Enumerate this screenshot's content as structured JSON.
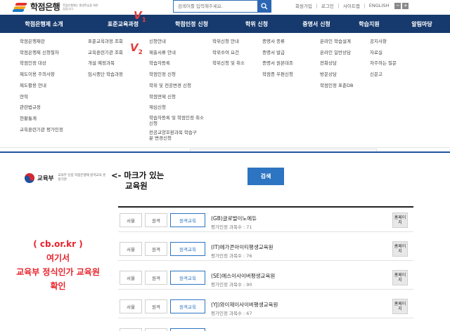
{
  "header": {
    "logo_text": "학점은행",
    "logo_sub": "학점은행제는 평생학습을 위한 길입니다.",
    "search_placeholder": "검색어를 입력해주세요.",
    "utils": [
      "회원가입",
      "로그인",
      "사이트맵",
      "ENGLISH"
    ],
    "font_minus": "−",
    "font_plus": "+"
  },
  "gnb": [
    "학점은행제 소개",
    "표준교육과정",
    "학점인정 신청",
    "학위 신청",
    "증명서 신청",
    "학습지원",
    "알림마당"
  ],
  "annotations": {
    "v1": "V",
    "v1_sub": "1",
    "v2": "V",
    "v2_sub": "2"
  },
  "dropdown": {
    "col0": [
      "학점은행제란",
      "학점은행제 신청절차",
      "학점인정 대상",
      "제도이용 주의사항",
      "제도활용 안내",
      "연혁",
      "관련법규정",
      "현황통계",
      "교육훈련기관 평가인정"
    ],
    "col1": [
      "표준교육과정 조회",
      "교육훈련기관 조회",
      "개설 예정과목",
      "임시중단 학습과정"
    ],
    "col2": [
      "신청안내",
      "제출서류 안내",
      "학습자등록",
      "학점인정 신청",
      "학위 및 전공변경 신청",
      "학점면제 신청",
      "재심신청",
      "학습자등록 및 학점인정 취소 신청",
      "전공교양호환과목 학습구분 변경신청"
    ],
    "col3": [
      "학위신청 안내",
      "학위수여 요건",
      "학위신청 및 취소"
    ],
    "col4": [
      "증명서 종류",
      "증명서 발급",
      "증명서 원본대조",
      "학점증 우편신청"
    ],
    "col5": [
      "온라인 학습설계",
      "온라인 일반상담",
      "전화상담",
      "방문상담",
      "학점인정 표준DB"
    ],
    "col6": [
      "공지사항",
      "자료실",
      "자주하는 질문",
      "신문고"
    ]
  },
  "moe": {
    "name": "교육부",
    "sub": "교육부 인증 학점은행제 원격교육 훈련기관"
  },
  "note": [
    "<- 마크가 있는",
    "교육원"
  ],
  "search_button": "검색",
  "red_note": [
    "( cb.or.kr )",
    "여기서",
    "교육부 정식인가 교육원",
    "확인"
  ],
  "list": {
    "tags": [
      "서울",
      "원격",
      "원격교육"
    ],
    "home_label": "홈페이지",
    "rows": [
      {
        "name": "(GB)글로벌이노에듀",
        "count": "평가인정 과목수 : 71"
      },
      {
        "name": "(IT)에가콘아이티평생교육원",
        "count": "평가인정 과목수 : 76"
      },
      {
        "name": "(SE)에스이사이버평생교육원",
        "count": "평가인정 과목수 : 90"
      },
      {
        "name": "(YJ)와이제이사이버평생교육원",
        "count": "평가인정 과목수 : 67"
      }
    ]
  },
  "colors": {
    "nav_bg": "#163a6d",
    "accent_blue": "#2d74c2",
    "annotation_red": "#e8232b"
  }
}
